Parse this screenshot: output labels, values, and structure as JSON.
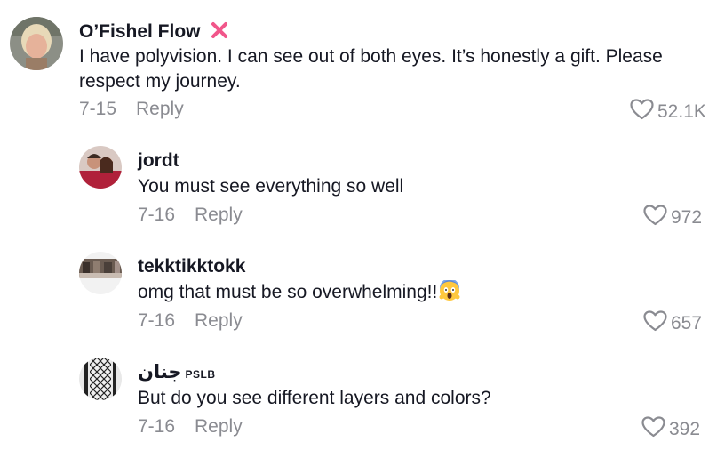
{
  "comments": [
    {
      "username": "O’Fishel Flow",
      "text": "I have polyvision. I can see out of both eyes. It’s honestly a gift. Please respect my journey.",
      "date": "7-15",
      "reply_label": "Reply",
      "likes": "52.1K",
      "avatar_icon": "profile-photo-woman"
    },
    {
      "username": "jordt",
      "text": "You must see everything so well",
      "date": "7-16",
      "reply_label": "Reply",
      "likes": "972",
      "avatar_icon": "profile-photo-couple"
    },
    {
      "username": "tekktikktokk",
      "text": "omg that must be so overwhelming!!",
      "emoji": "😱",
      "date": "7-16",
      "reply_label": "Reply",
      "likes": "657",
      "avatar_icon": "profile-photo-group"
    },
    {
      "username": "جنان",
      "badge": "PSLB",
      "text": "But do you see different layers and colors?",
      "date": "7-16",
      "reply_label": "Reply",
      "likes": "392",
      "avatar_icon": "profile-photo-keffiyeh-pattern"
    }
  ],
  "colors": {
    "text": "#161823",
    "muted": "#8a8b91",
    "x_icon": "#f1568a"
  },
  "icons": [
    "heart-outline-icon",
    "cross-mark-icon",
    "face-screaming-emoji"
  ]
}
